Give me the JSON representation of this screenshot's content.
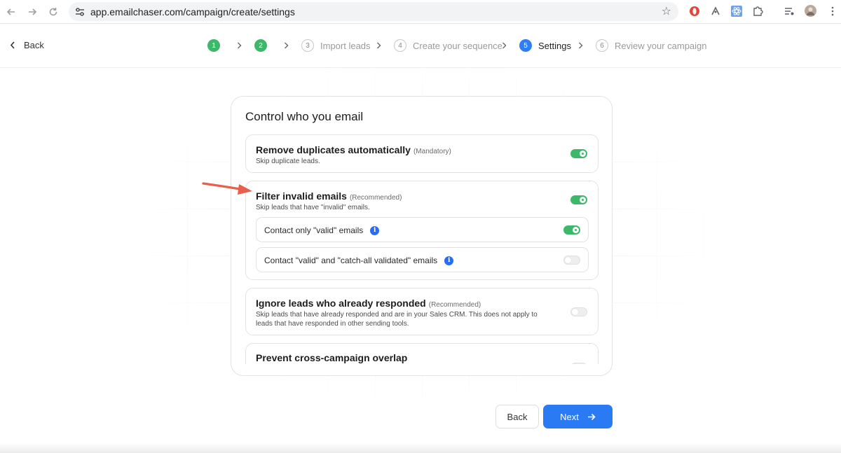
{
  "browser": {
    "url": "app.emailchaser.com/campaign/create/settings"
  },
  "header": {
    "back_label": "Back",
    "steps": [
      {
        "num": "1",
        "label": "",
        "state": "done"
      },
      {
        "num": "2",
        "label": "",
        "state": "done"
      },
      {
        "num": "3",
        "label": "Import leads",
        "state": "todo"
      },
      {
        "num": "4",
        "label": "Create your sequence",
        "state": "todo"
      },
      {
        "num": "5",
        "label": "Settings",
        "state": "active"
      },
      {
        "num": "6",
        "label": "Review your campaign",
        "state": "todo"
      }
    ]
  },
  "card": {
    "title": "Control who you email",
    "remove_duplicates": {
      "title": "Remove duplicates automatically",
      "tag": "(Mandatory)",
      "desc": "Skip duplicate leads.",
      "enabled": true
    },
    "filter_invalid": {
      "title": "Filter invalid emails",
      "tag": "(Recommended)",
      "desc": "Skip leads that have \"invalid\" emails.",
      "enabled": true,
      "options": [
        {
          "label": "Contact only \"valid\" emails",
          "enabled": true
        },
        {
          "label": "Contact \"valid\" and \"catch-all validated\" emails",
          "enabled": false
        }
      ]
    },
    "ignore_responded": {
      "title": "Ignore leads who already responded",
      "tag": "(Recommended)",
      "desc_line1": "Skip leads that have already responded and are in your Sales CRM. This does not apply to",
      "desc_line2": "leads that have responded in other sending tools.",
      "enabled": false
    },
    "cross_campaign": {
      "title": "Prevent cross-campaign overlap"
    }
  },
  "footer": {
    "back_label": "Back",
    "next_label": "Next"
  },
  "colors": {
    "green": "#3db86b",
    "blue": "#2a7bf3",
    "annotation_arrow": "#e8604c"
  }
}
